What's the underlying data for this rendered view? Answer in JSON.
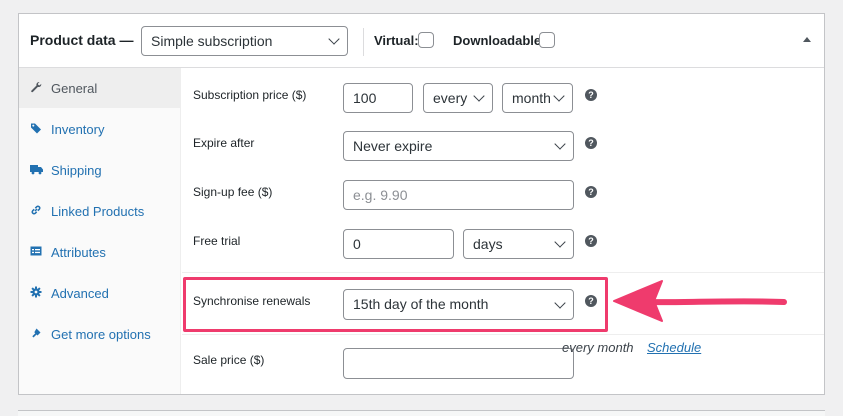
{
  "header": {
    "title": "Product data —",
    "product_type": "Simple subscription",
    "virtual_label": "Virtual:",
    "downloadable_label": "Downloadable:",
    "virtual_checked": false,
    "downloadable_checked": false
  },
  "sidebar": {
    "items": [
      {
        "label": "General",
        "icon": "wrench-icon",
        "active": true
      },
      {
        "label": "Inventory",
        "icon": "tag-icon",
        "active": false
      },
      {
        "label": "Shipping",
        "icon": "truck-icon",
        "active": false
      },
      {
        "label": "Linked Products",
        "icon": "link-icon",
        "active": false
      },
      {
        "label": "Attributes",
        "icon": "list-icon",
        "active": false
      },
      {
        "label": "Advanced",
        "icon": "gear-icon",
        "active": false
      },
      {
        "label": "Get more options",
        "icon": "plugin-icon",
        "active": false
      }
    ]
  },
  "fields": {
    "subscription_price": {
      "label": "Subscription price ($)",
      "value": "100",
      "interval": "every",
      "period": "month"
    },
    "expire_after": {
      "label": "Expire after",
      "value": "Never expire"
    },
    "signup_fee": {
      "label": "Sign-up fee ($)",
      "placeholder": "e.g. 9.90"
    },
    "free_trial": {
      "label": "Free trial",
      "value": "0",
      "unit": "days"
    },
    "sync_renewals": {
      "label": "Synchronise renewals",
      "value": "15th day of the month"
    },
    "sale_price": {
      "label": "Sale price ($)",
      "value": "",
      "suffix": "every month",
      "schedule_link": "Schedule"
    }
  },
  "help_icon_glyph": "?",
  "colors": {
    "accent": "#2271b1",
    "highlight": "#ef3b6d"
  }
}
